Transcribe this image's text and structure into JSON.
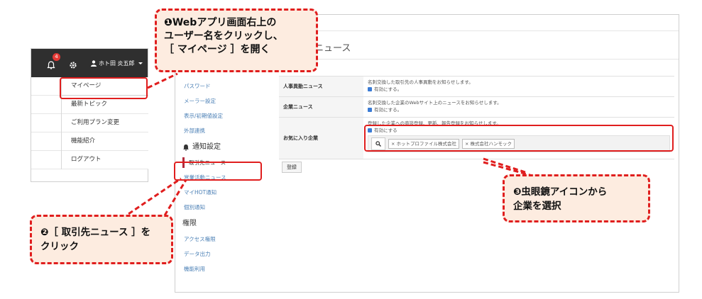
{
  "nav": {
    "notification_count": "4",
    "user_name": "ホト田 炎五郎"
  },
  "dropdown": {
    "items": [
      "マイページ",
      "最新トピック",
      "ご利用プラン変更",
      "機能紹介",
      "ログアウト"
    ]
  },
  "page": {
    "title": "ニュース"
  },
  "sidebar": {
    "items_top": [
      "パスワード",
      "メーラー設定",
      "表示/初期値設定",
      "外部連携"
    ],
    "section_notify": "通知設定",
    "notify_items": [
      "取引先ニュース",
      "営業活動ニュース",
      "マイHOT通知",
      "個別通知"
    ],
    "section_perm": "権限",
    "perm_items": [
      "アクセス権限",
      "データ出力",
      "機能利用"
    ]
  },
  "settings": {
    "rows": [
      {
        "label": "人事異動ニュース",
        "desc": "名刺交換した取引先の人事異動をお知らせします。",
        "check": "有効にする。"
      },
      {
        "label": "企業ニュース",
        "desc": "名刺交換した企業のWebサイト上のニュースをお知らせします。",
        "check": "有効にする。"
      },
      {
        "label": "お気に入り企業",
        "desc": "登録した企業への商談登録、更新、報告登録をお知らせします。",
        "check": "有効にする"
      }
    ],
    "tags": [
      "ホットプロファイル株式会社",
      "株式会社ハンモック"
    ],
    "register_label": "登録"
  },
  "callouts": {
    "c1": [
      "❶Webアプリ画面右上の",
      "ユーザー名をクリックし、",
      "［ マイページ ］を開く"
    ],
    "c2": [
      "❷［ 取引先ニュース ］を",
      "クリック"
    ],
    "c3": [
      "❸虫眼鏡アイコンから",
      "企業を選択"
    ]
  },
  "colors": {
    "highlight": "#e01e1e",
    "callout_bg": "#fdece0",
    "navbar": "#2f2f2f",
    "active_marker": "#b22a3b"
  }
}
